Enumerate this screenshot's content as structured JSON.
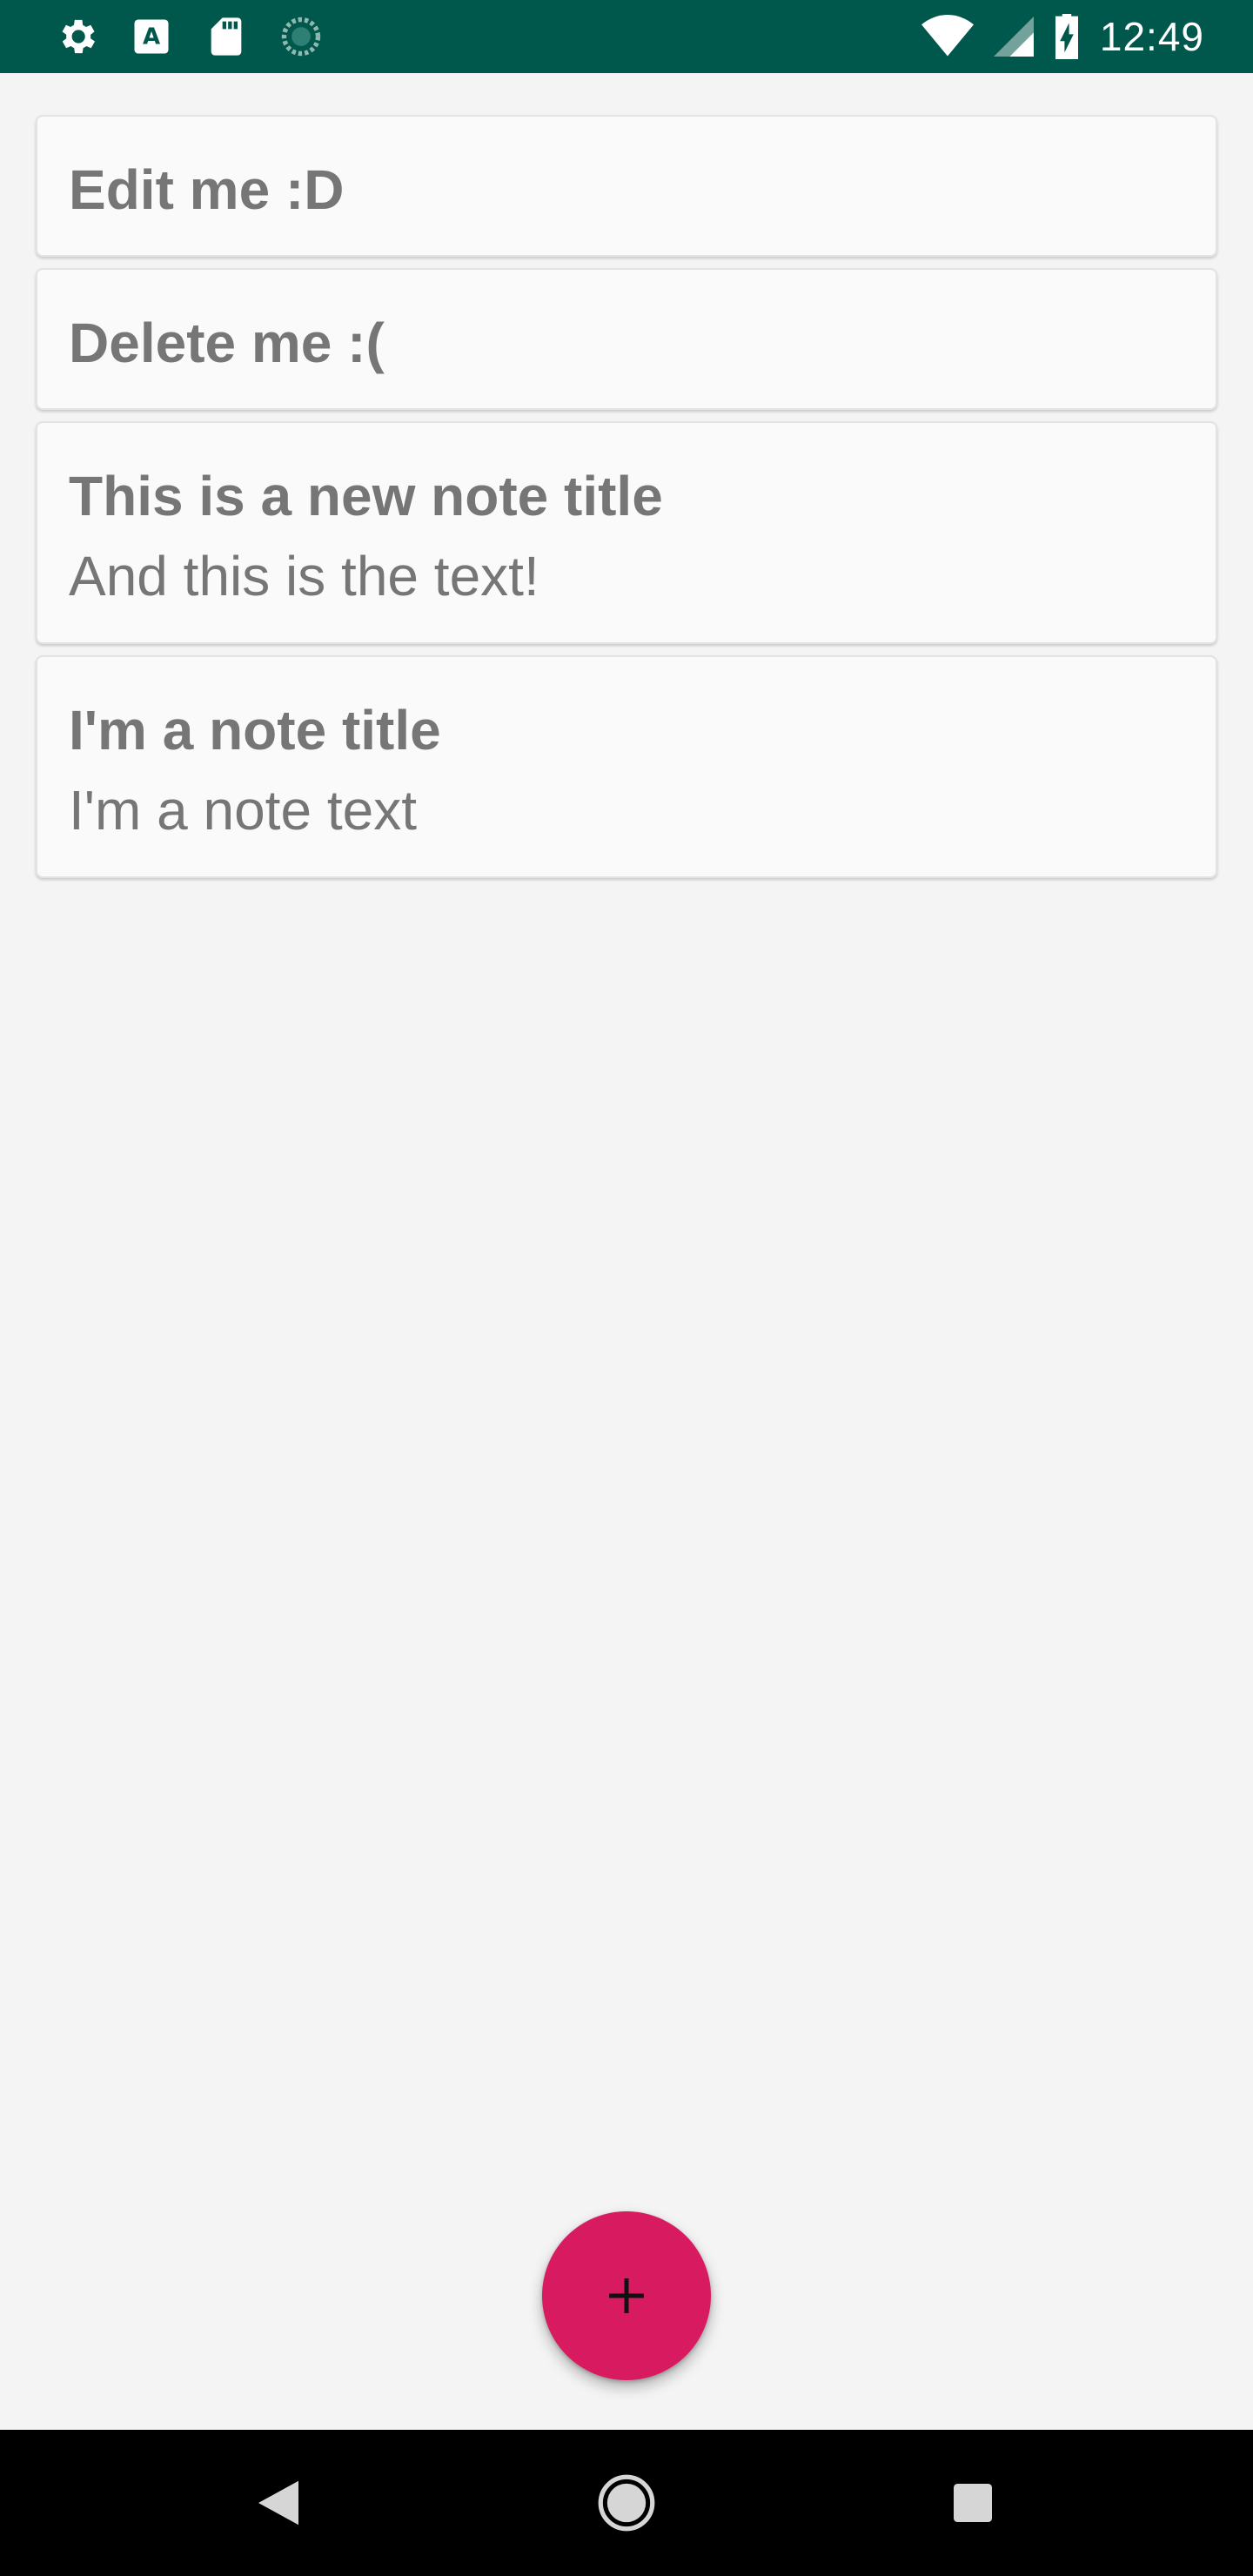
{
  "status_bar": {
    "time": "12:49",
    "icons_left": [
      "settings-icon",
      "text-a-icon",
      "sd-card-icon",
      "sync-progress-icon"
    ],
    "icons_right": [
      "wifi-icon",
      "cell-signal-icon",
      "battery-charging-icon"
    ],
    "background_color": "#00574b"
  },
  "notes": [
    {
      "title": "Edit me :D",
      "text": ""
    },
    {
      "title": "Delete me :(",
      "text": ""
    },
    {
      "title": "This is a new note title",
      "text": "And this is the text!"
    },
    {
      "title": "I'm a note title",
      "text": "I'm a note text"
    }
  ],
  "fab": {
    "icon": "plus-icon",
    "color": "#d81b60"
  },
  "nav_bar": {
    "buttons": [
      "back-icon",
      "home-icon",
      "recents-icon"
    ]
  }
}
